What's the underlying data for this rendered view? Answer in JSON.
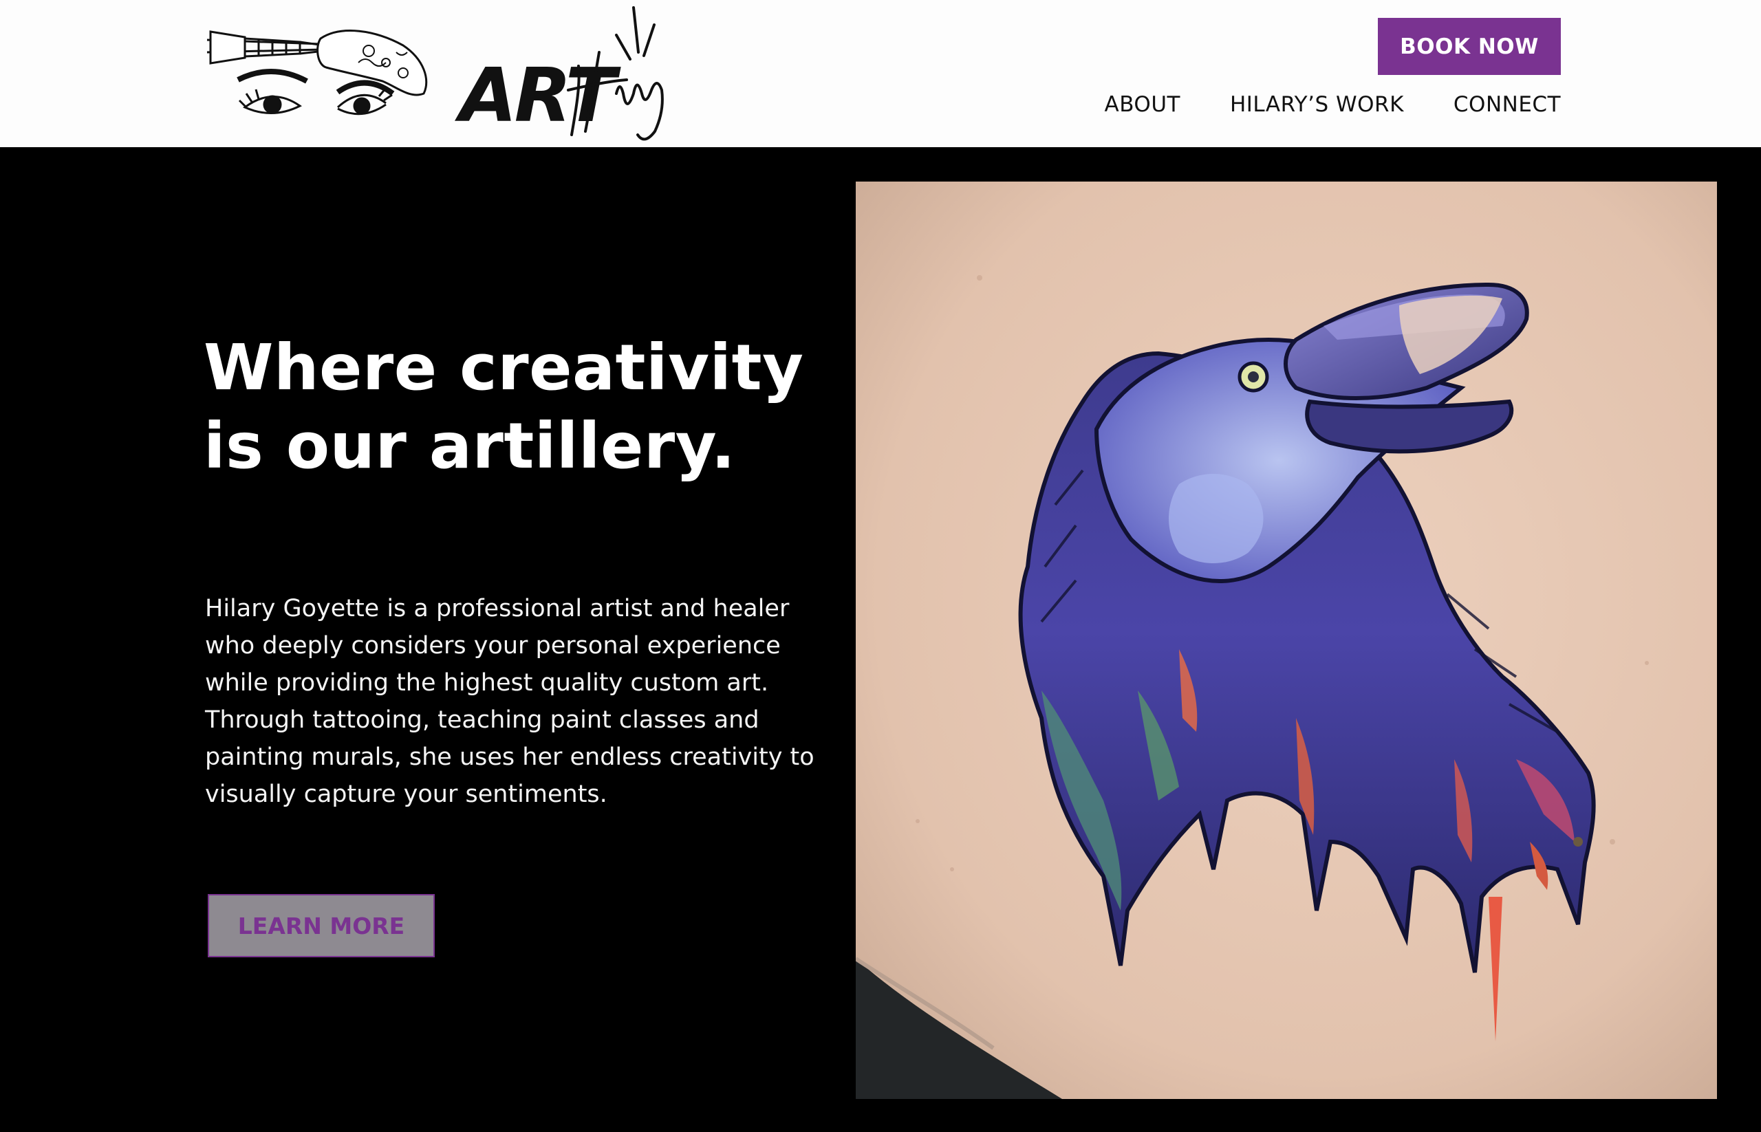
{
  "header": {
    "logo_alt": "ART Hilary",
    "book_label": "BOOK NOW",
    "nav": [
      {
        "label": "ABOUT"
      },
      {
        "label": "HILARY’S WORK"
      },
      {
        "label": "CONNECT"
      }
    ]
  },
  "hero": {
    "title_line1": "Where creativity",
    "title_line2": "is our artillery.",
    "body_lines": [
      "Hilary Goyette is a professional artist and healer",
      "who deeply considers your personal experience",
      "while providing the highest quality custom art.",
      "Through tattooing, teaching paint classes and",
      "painting murals, she uses her endless creativity to",
      "visually capture your sentiments."
    ],
    "cta_label": "LEARN MORE"
  },
  "colors": {
    "brand_purple": "#7a3391",
    "background": "#000000",
    "header_bg": "#fdfdfd"
  }
}
